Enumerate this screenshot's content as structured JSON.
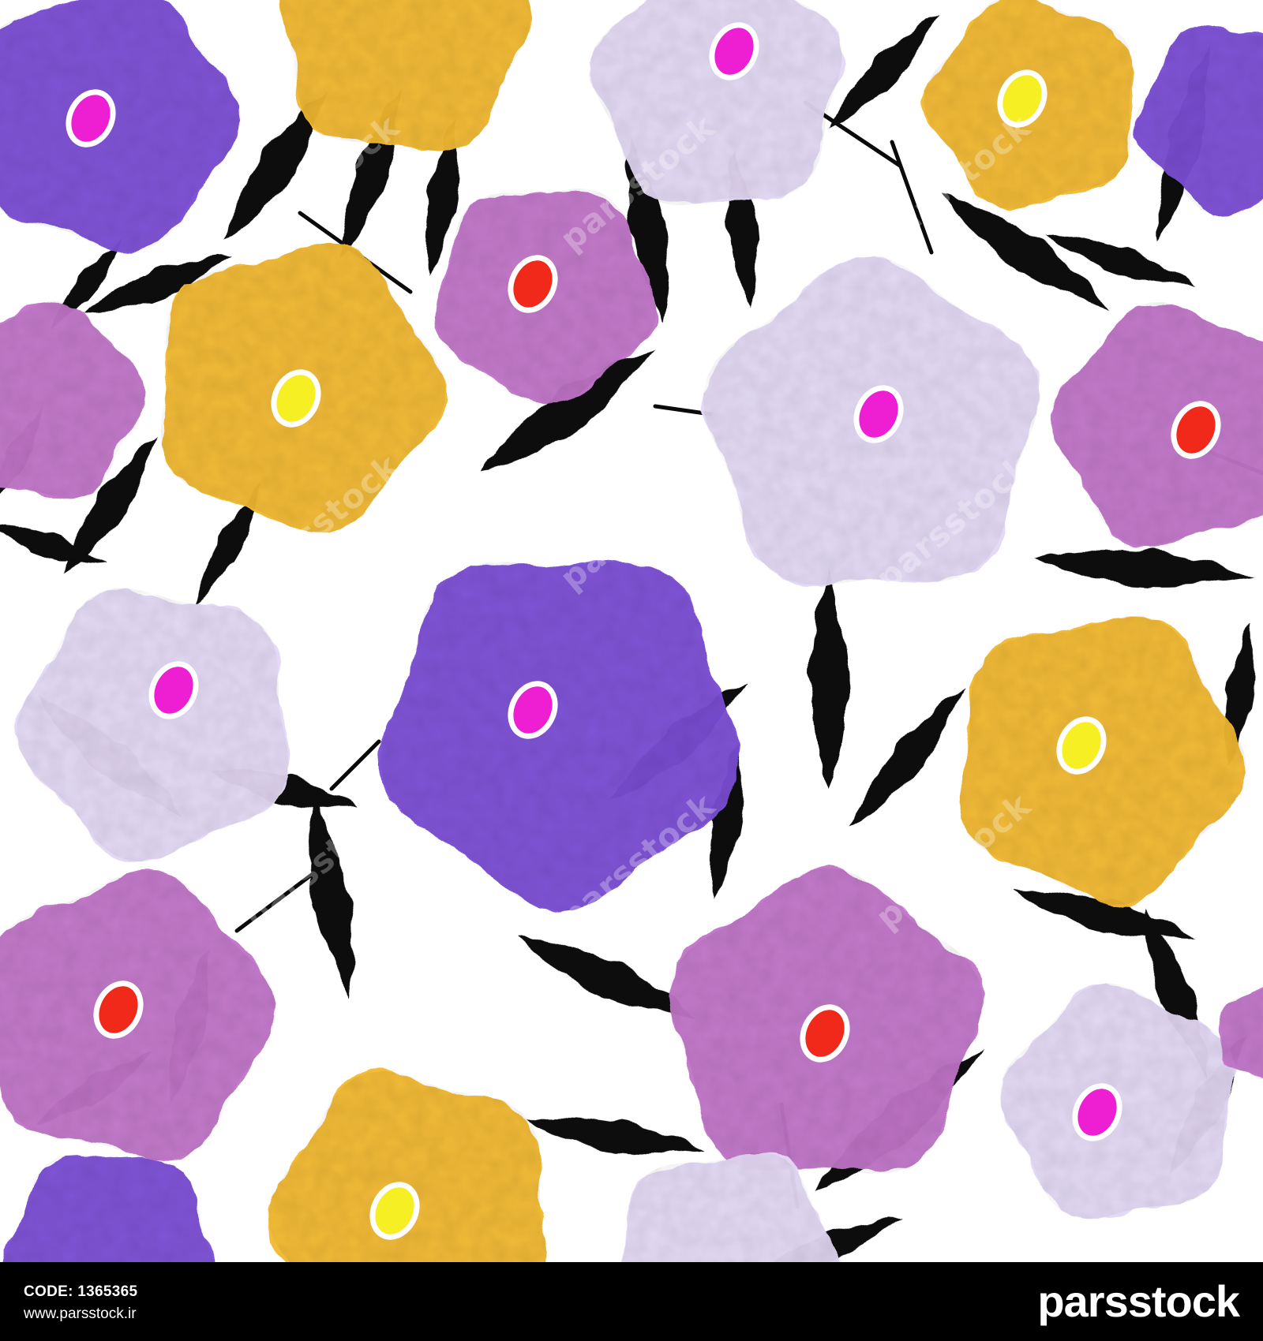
{
  "artwork": {
    "palette": {
      "violet": "#7b4fd6",
      "lavender": "#e4d9f5",
      "orchid": "#c276c9",
      "saffron": "#f2b932",
      "leaf": "#0a0a0a",
      "center_magenta": "#ee1fd2",
      "center_red": "#f0291a",
      "center_yellow": "#f5ef24"
    }
  },
  "watermark": {
    "text": "parsstock"
  },
  "footer": {
    "code_label": "CODE: 1365365",
    "site": "www.parsstock.ir",
    "logo_text": "parsstock"
  }
}
